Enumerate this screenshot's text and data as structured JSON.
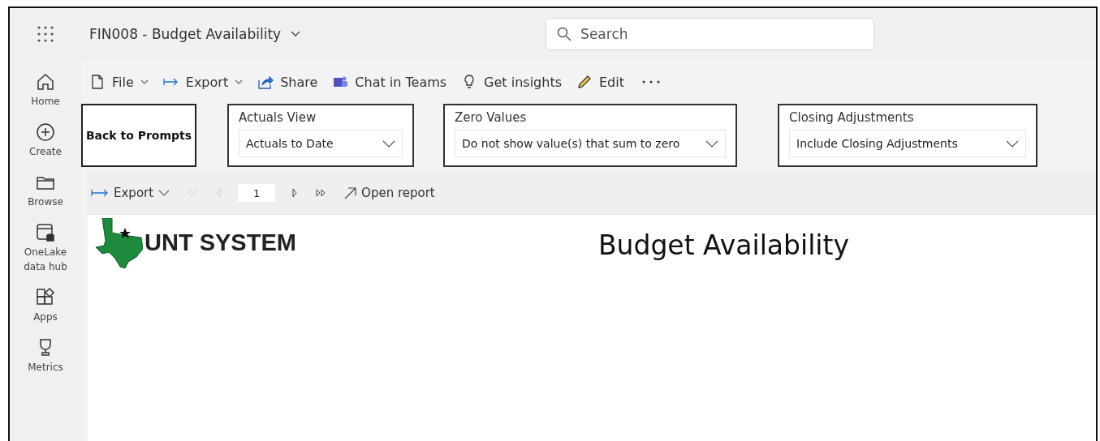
{
  "header": {
    "title": "FIN008 - Budget Availability",
    "search": {
      "placeholder": "Search"
    }
  },
  "nav": [
    {
      "label": "Home"
    },
    {
      "label": "Create"
    },
    {
      "label": "Browse"
    },
    {
      "label": "OneLake data hub"
    },
    {
      "label": "Apps"
    },
    {
      "label": "Metrics"
    }
  ],
  "toolbar": [
    {
      "label": "File",
      "has_menu": true
    },
    {
      "label": "Export",
      "has_menu": true
    },
    {
      "label": "Share",
      "has_menu": false
    },
    {
      "label": "Chat in Teams",
      "has_menu": false
    },
    {
      "label": "Get insights",
      "has_menu": false
    },
    {
      "label": "Edit",
      "has_menu": false
    }
  ],
  "back_button": "Back to Prompts",
  "slicers": [
    {
      "title": "Actuals View",
      "value": "Actuals to Date"
    },
    {
      "title": "Zero Values",
      "value": "Do not show value(s) that sum to zero"
    },
    {
      "title": "Closing Adjustments",
      "value": "Include Closing Adjustments"
    }
  ],
  "report_toolbar": {
    "export": "Export",
    "page": "1",
    "open_report": "Open report"
  },
  "report": {
    "logo_text": "UNT SYSTEM",
    "title": "Budget Availability"
  }
}
